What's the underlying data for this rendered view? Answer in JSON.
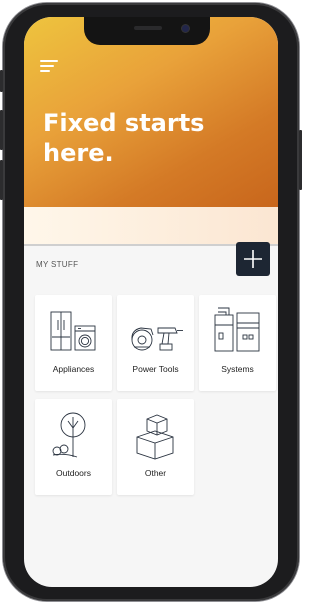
{
  "hero": {
    "title": "Fixed starts\nhere."
  },
  "my_stuff": {
    "label": "MY STUFF",
    "add_button_icon": "plus-icon"
  },
  "categories": [
    {
      "label": "Appliances",
      "icon": "appliances-icon"
    },
    {
      "label": "Power Tools",
      "icon": "power-tools-icon"
    },
    {
      "label": "Systems",
      "icon": "systems-icon"
    },
    {
      "label": "Outdoors",
      "icon": "outdoors-icon"
    },
    {
      "label": "Other",
      "icon": "other-icon"
    }
  ],
  "colors": {
    "hero_gradient_start": "#eec43e",
    "hero_gradient_end": "#c8661c",
    "add_button": "#1d2633",
    "icon_stroke": "#2a3340"
  }
}
